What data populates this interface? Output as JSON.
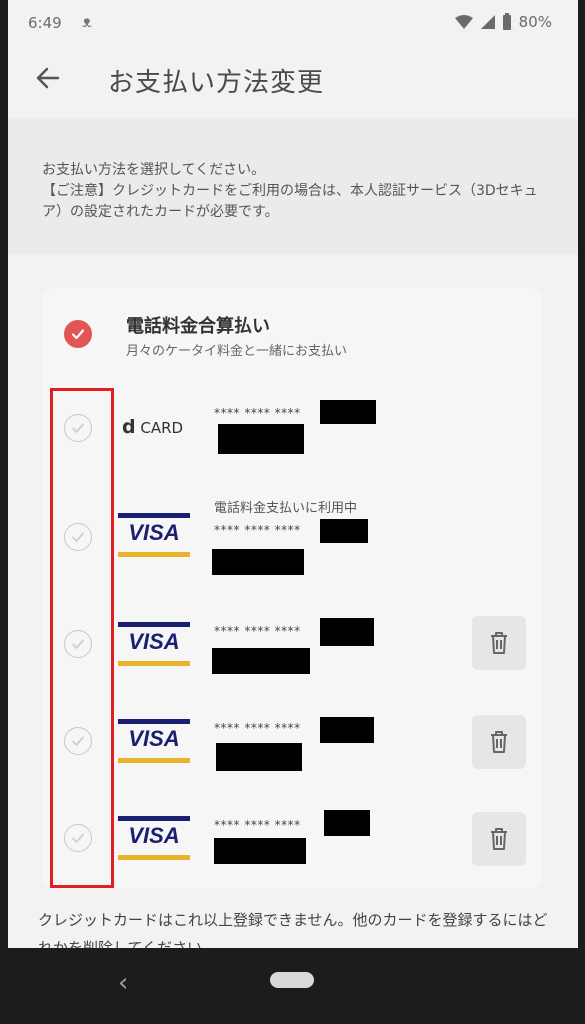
{
  "status": {
    "time": "6:49",
    "battery": "80%"
  },
  "header": {
    "title": "お支払い方法変更"
  },
  "notice": {
    "line1": "お支払い方法を選択してください。",
    "line2": "【ご注意】クレジットカードをご利用の場合は、本人認証サービス（3Dセキュア）の設定されたカードが必要です。"
  },
  "methods": {
    "carrier": {
      "title": "電話料金合算払い",
      "subtitle": "月々のケータイ料金と一緒にお支払い"
    },
    "cards": [
      {
        "brand": "CARD",
        "brand_prefix": "d",
        "number_mask": "**** **** ****",
        "note": ""
      },
      {
        "brand": "VISA",
        "number_mask": "**** **** ****",
        "note": "電話料金支払いに利用中"
      },
      {
        "brand": "VISA",
        "number_mask": "**** **** ****",
        "note": ""
      },
      {
        "brand": "VISA",
        "number_mask": "**** **** ****",
        "note": ""
      },
      {
        "brand": "VISA",
        "number_mask": "**** **** ****",
        "note": ""
      }
    ]
  },
  "footer": {
    "text": "クレジットカードはこれ以上登録できません。他のカードを登録するにはどれかを削除してください。"
  },
  "icons": {
    "back": "arrow-left-icon",
    "delete": "trash-icon",
    "check": "check-icon"
  },
  "colors": {
    "accent": "#e05555",
    "visa_blue": "#1a1f71",
    "visa_gold": "#e8b22a",
    "highlight": "#e02020"
  }
}
